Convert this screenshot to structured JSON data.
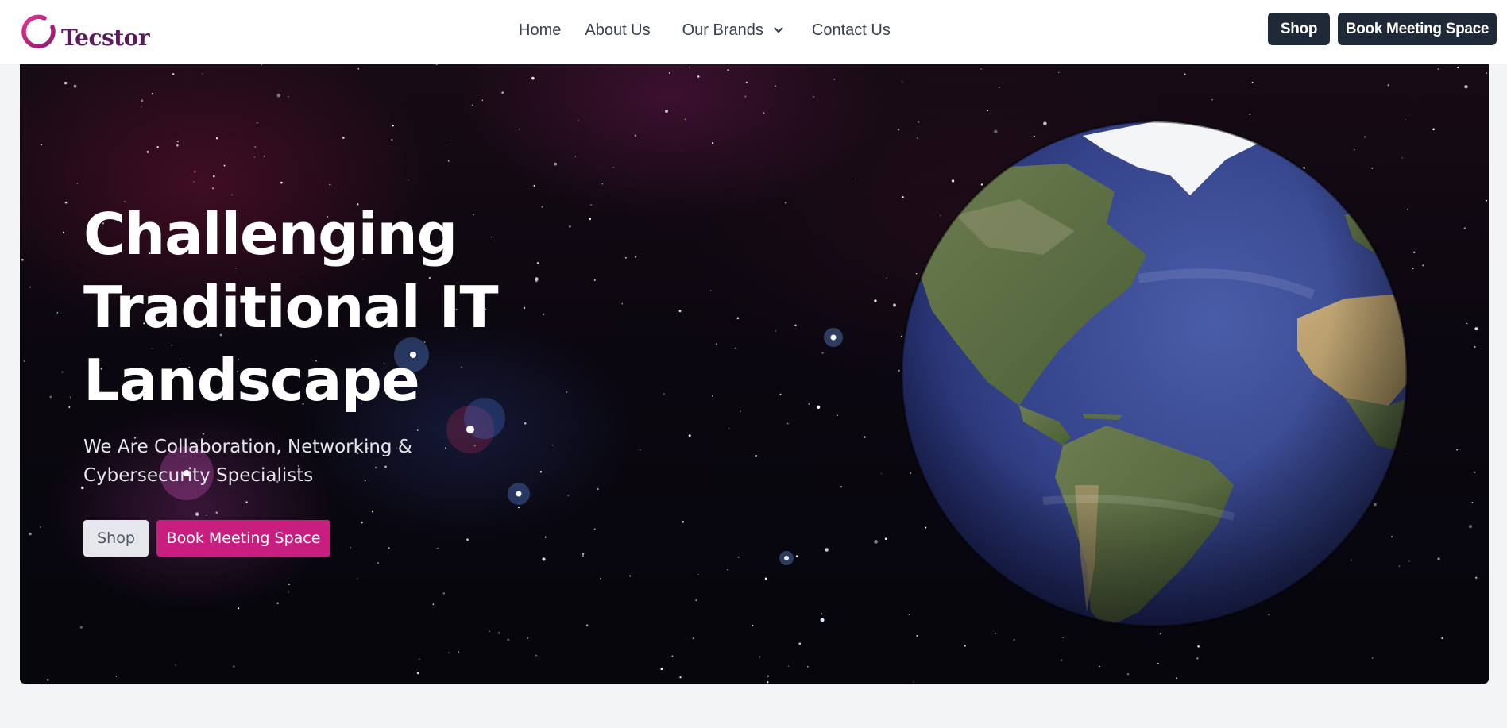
{
  "brand": {
    "name": "Tecstor",
    "accent": "#c81e7f",
    "logo_text_color": "#5b1a5e"
  },
  "nav": {
    "items": [
      {
        "label": "Home"
      },
      {
        "label": "About Us"
      },
      {
        "label": "Our Brands",
        "has_dropdown": true
      },
      {
        "label": "Contact Us"
      }
    ]
  },
  "header_actions": {
    "shop_label": "Shop",
    "book_label": "Book Meeting Space",
    "button_color": "#1f2937"
  },
  "hero": {
    "headline": "Challenging Traditional IT Landscape",
    "subtitle": "We Are Collaboration, Networking & Cybersecurity Specialists",
    "shop_label": "Shop",
    "book_label": "Book Meeting Space",
    "background": "starfield-space-image",
    "image": "earth-globe-americas"
  }
}
